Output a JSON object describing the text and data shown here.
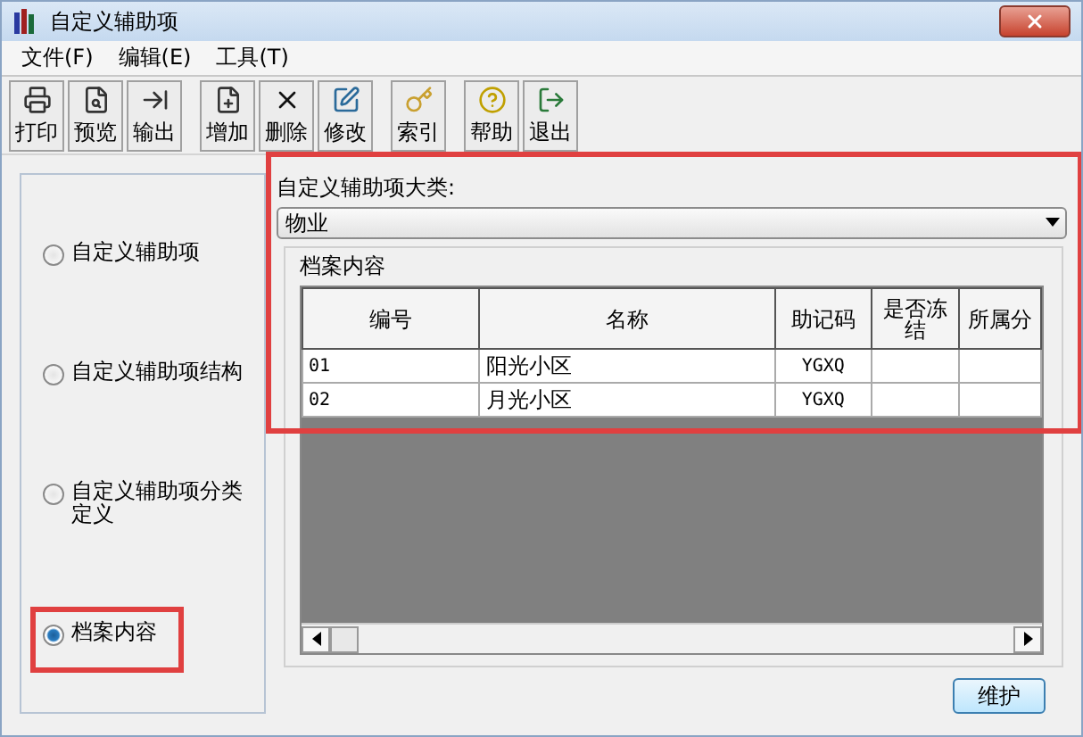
{
  "window": {
    "title": "自定义辅助项"
  },
  "menu": [
    "文件(F)",
    "编辑(E)",
    "工具(T)"
  ],
  "toolbar": [
    {
      "buttons": [
        "打印",
        "预览",
        "输出"
      ]
    },
    {
      "buttons": [
        "增加",
        "删除",
        "修改"
      ]
    },
    {
      "buttons": [
        "索引"
      ]
    },
    {
      "buttons": [
        "帮助",
        "退出"
      ]
    }
  ],
  "options": [
    {
      "label": "自定义辅助项",
      "selected": false
    },
    {
      "label": "自定义辅助项结构",
      "selected": false
    },
    {
      "label": "自定义辅助项分类定义",
      "selected": false
    },
    {
      "label": "档案内容",
      "selected": true
    }
  ],
  "category": {
    "label": "自定义辅助项大类:",
    "value": "物业"
  },
  "archive": {
    "title": "档案内容",
    "columns": [
      "编号",
      "名称",
      "助记码",
      "是否冻结",
      "所属分"
    ],
    "rows": [
      [
        "01",
        "阳光小区",
        "YGXQ",
        "",
        ""
      ],
      [
        "02",
        "月光小区",
        "YGXQ",
        "",
        ""
      ]
    ]
  },
  "buttons": [
    "维护"
  ]
}
